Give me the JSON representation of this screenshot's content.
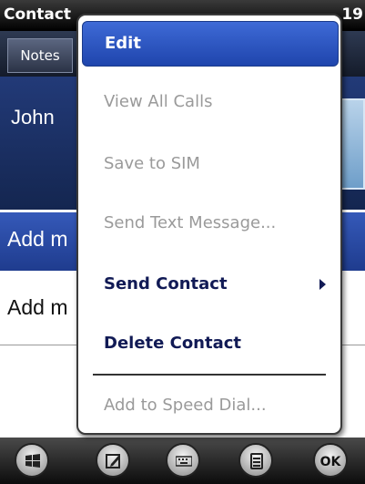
{
  "app": {
    "title": "Contact",
    "clock": "19"
  },
  "tabs": [
    {
      "label": "Notes"
    }
  ],
  "contact": {
    "name": "John"
  },
  "fields": [
    {
      "label": "Add m"
    },
    {
      "label": "Add m"
    }
  ],
  "menu": {
    "items": [
      {
        "label": "Edit",
        "state": "highlighted"
      },
      {
        "label": "View All Calls",
        "state": "disabled"
      },
      {
        "label": "Save to SIM",
        "state": "disabled"
      },
      {
        "label": "Send Text Message...",
        "state": "disabled"
      },
      {
        "label": "Send Contact",
        "state": "enabled",
        "submenu": true
      },
      {
        "label": "Delete Contact",
        "state": "enabled"
      },
      {
        "label": "Add to Speed Dial...",
        "state": "disabled"
      }
    ]
  },
  "softkeys": {
    "start_icon": "windows-start-icon",
    "edit_icon": "pencil-edit-icon",
    "keyboard_icon": "keyboard-icon",
    "menu_icon": "menu-list-icon",
    "ok_label": "OK"
  }
}
